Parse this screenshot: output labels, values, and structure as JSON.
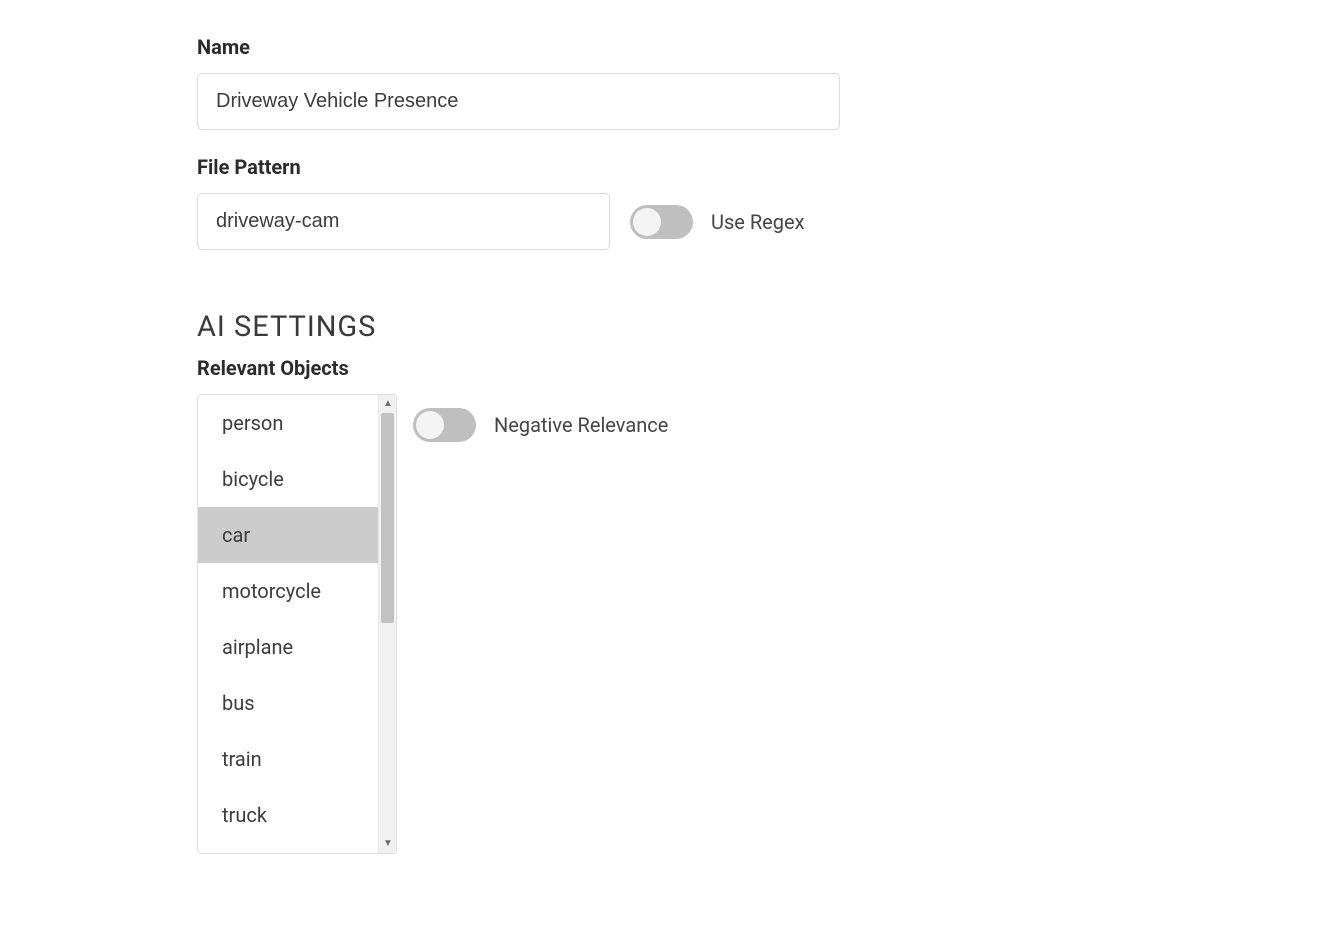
{
  "name": {
    "label": "Name",
    "value": "Driveway Vehicle Presence"
  },
  "file_pattern": {
    "label": "File Pattern",
    "value": "driveway-cam",
    "use_regex_label": "Use Regex",
    "use_regex_on": false
  },
  "ai_settings": {
    "heading": "AI SETTINGS",
    "relevant_objects_label": "Relevant Objects",
    "negative_relevance_label": "Negative Relevance",
    "negative_relevance_on": false,
    "objects": [
      {
        "label": "person",
        "selected": false
      },
      {
        "label": "bicycle",
        "selected": false
      },
      {
        "label": "car",
        "selected": true
      },
      {
        "label": "motorcycle",
        "selected": false
      },
      {
        "label": "airplane",
        "selected": false
      },
      {
        "label": "bus",
        "selected": false
      },
      {
        "label": "train",
        "selected": false
      },
      {
        "label": "truck",
        "selected": false
      }
    ]
  }
}
